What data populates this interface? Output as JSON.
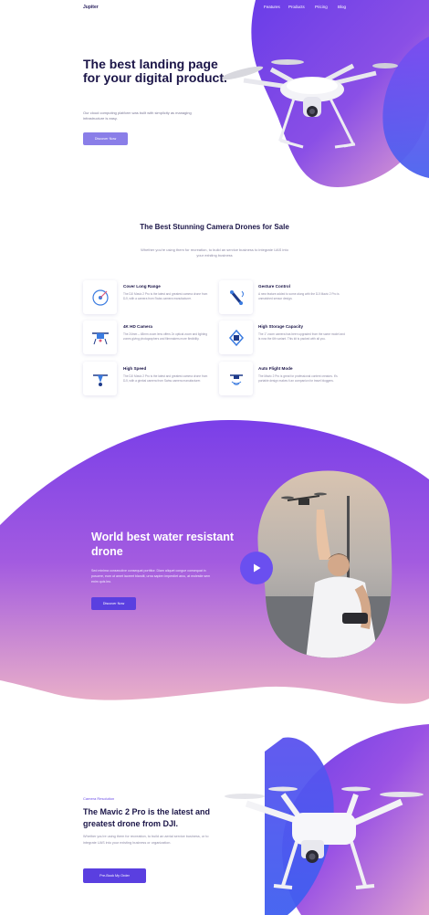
{
  "nav": {
    "logo": "Jupiter",
    "links": [
      "Features",
      "Products",
      "Pricing",
      "Blog"
    ]
  },
  "hero": {
    "title": "The best landing page for your digital product.",
    "text": "Our cloud computing platform was built with simplicity as managing infrastructure is easy.",
    "button": "Discover Now"
  },
  "features": {
    "title": "The Best Stunning Camera Drones for Sale",
    "subtitle": "Whether you're using them for recreation, to build an service business to integrate UAS into your existing business",
    "items": [
      {
        "icon": "range-target-icon",
        "title": "Cover Long Range",
        "text": "The DJI Mavic 2 Pro is the latest and greatest camera drone from DJI, with a camera from Swiss camera manufacturer."
      },
      {
        "icon": "gesture-drone-icon",
        "title": "Gesture Control",
        "text": "A new feature added to some along with the DJI Mavic 2 Pro is unmatched sensor design."
      },
      {
        "icon": "camera-drone-icon",
        "title": "4K HD Camera",
        "text": "The 24mm – 48mm zoom lens offers 2x optical zoom and lighting zones giving photographers and filmmakers more flexibility."
      },
      {
        "icon": "storage-icon",
        "title": "High Storage Capacity",
        "text": "The 1\" zoom camera has been upgraded from the same model and is now the 6th variant. This kit is packed with all you."
      },
      {
        "icon": "speed-drone-icon",
        "title": "High Speed",
        "text": "The DJI Mavic 2 Pro is the latest and greatest camera drone from DJI, with a gimbal camera from Swiss camera manufacturer."
      },
      {
        "icon": "auto-flight-icon",
        "title": "Auto Flight Mode",
        "text": "The Mavic 2 Pro is great for professional content creators. It's portable design makes it an companion for travel bloggers."
      }
    ]
  },
  "water": {
    "title": "World best water resistant drone",
    "text": "Sed minima consecutive consequat porttitor. Diam aliquet congue consequat in posuere, eum ut amet laoreet blandit, urna sapien imperdiet arcu, at molestie sem enim quis leo.",
    "button": "Discover Now"
  },
  "mavic": {
    "kicker": "Camera Resolution",
    "title": "The Mavic 2 Pro is the latest and greatest drone from DJI.",
    "text": "Whether you're using them for recreation, to build an aerial service business, or to integrate UAS into your existing business or organization.",
    "button": "Pre-Book My Order"
  },
  "colors": {
    "accent": "#6c4ee8",
    "gradient_start": "#9b49e8",
    "gradient_end": "#4b5ef0",
    "pink": "#e5a3cc"
  }
}
